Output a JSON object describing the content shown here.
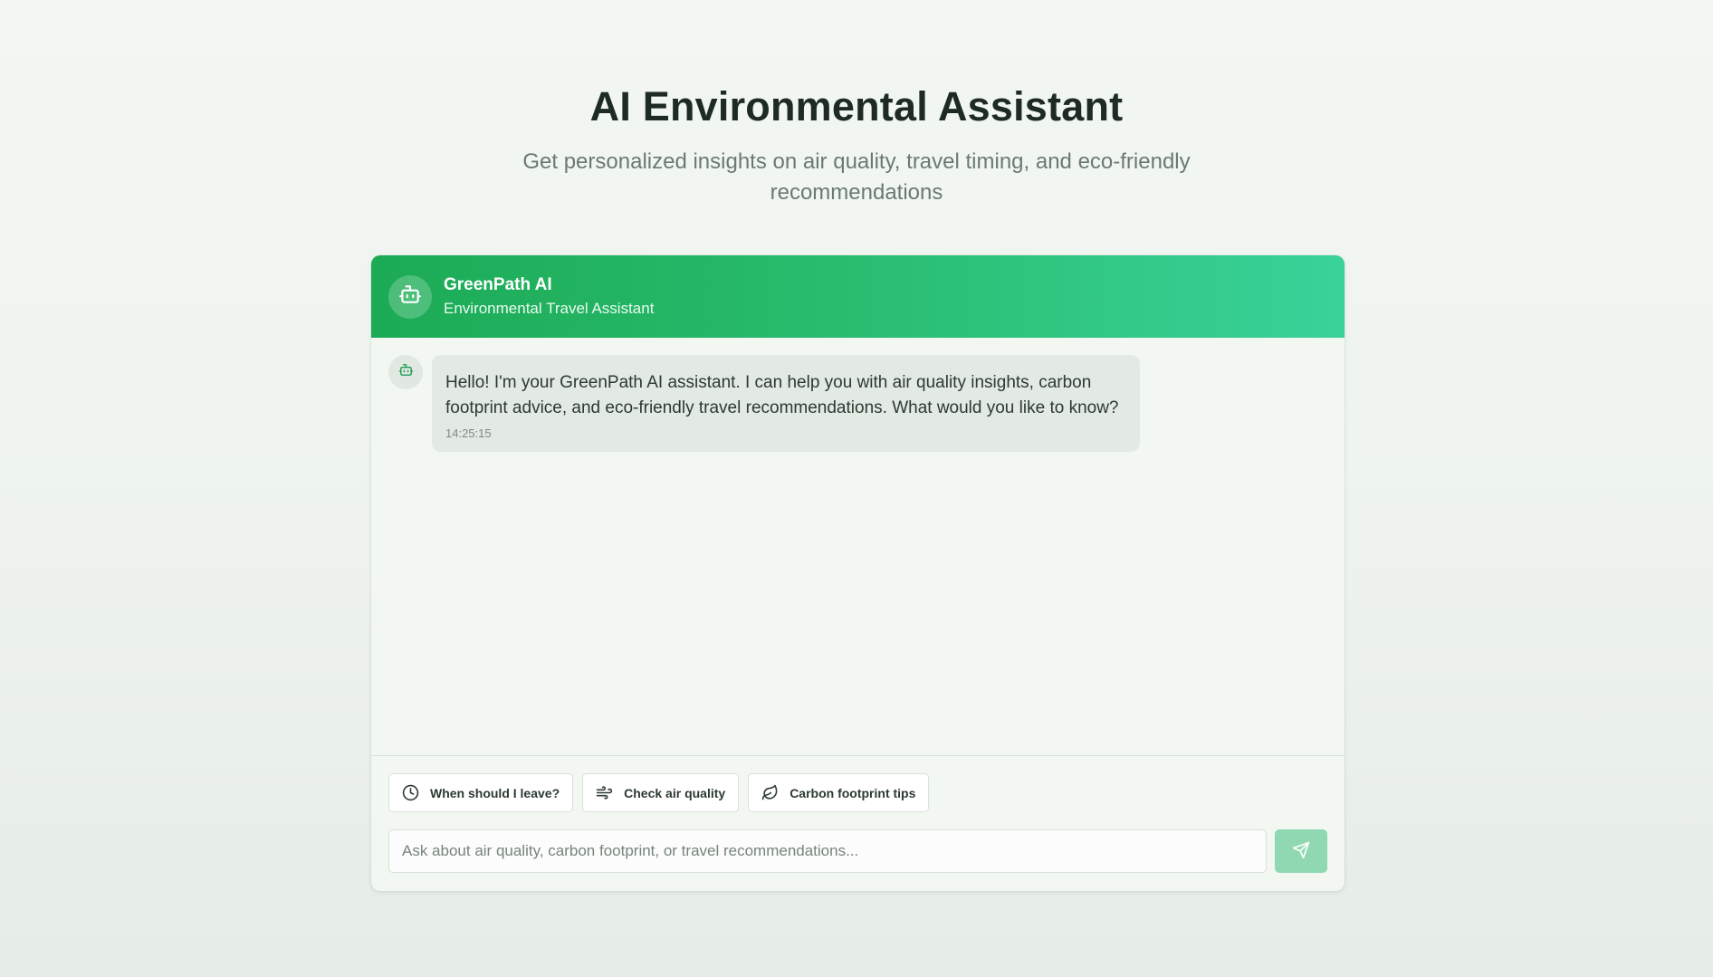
{
  "page": {
    "title": "AI Environmental Assistant",
    "subtitle": "Get personalized insights on air quality, travel timing, and eco-friendly recommendations"
  },
  "chat": {
    "header": {
      "name": "GreenPath AI",
      "role": "Environmental Travel Assistant",
      "avatar_icon": "robot-icon"
    },
    "messages": [
      {
        "sender": "bot",
        "text": "Hello! I'm your GreenPath AI assistant. I can help you with air quality insights, carbon footprint advice, and eco-friendly travel recommendations. What would you like to know?",
        "time": "14:25:15"
      }
    ],
    "quick_actions": [
      {
        "label": "When should I leave?",
        "icon": "clock-icon"
      },
      {
        "label": "Check air quality",
        "icon": "wind-icon"
      },
      {
        "label": "Carbon footprint tips",
        "icon": "leaf-icon"
      }
    ],
    "input": {
      "value": "",
      "placeholder": "Ask about air quality, carbon footprint, or travel recommendations..."
    },
    "send_icon": "send-icon"
  },
  "colors": {
    "accent_start": "#1caa55",
    "accent_end": "#3ad29a",
    "send_button": "#8fd8b2"
  }
}
